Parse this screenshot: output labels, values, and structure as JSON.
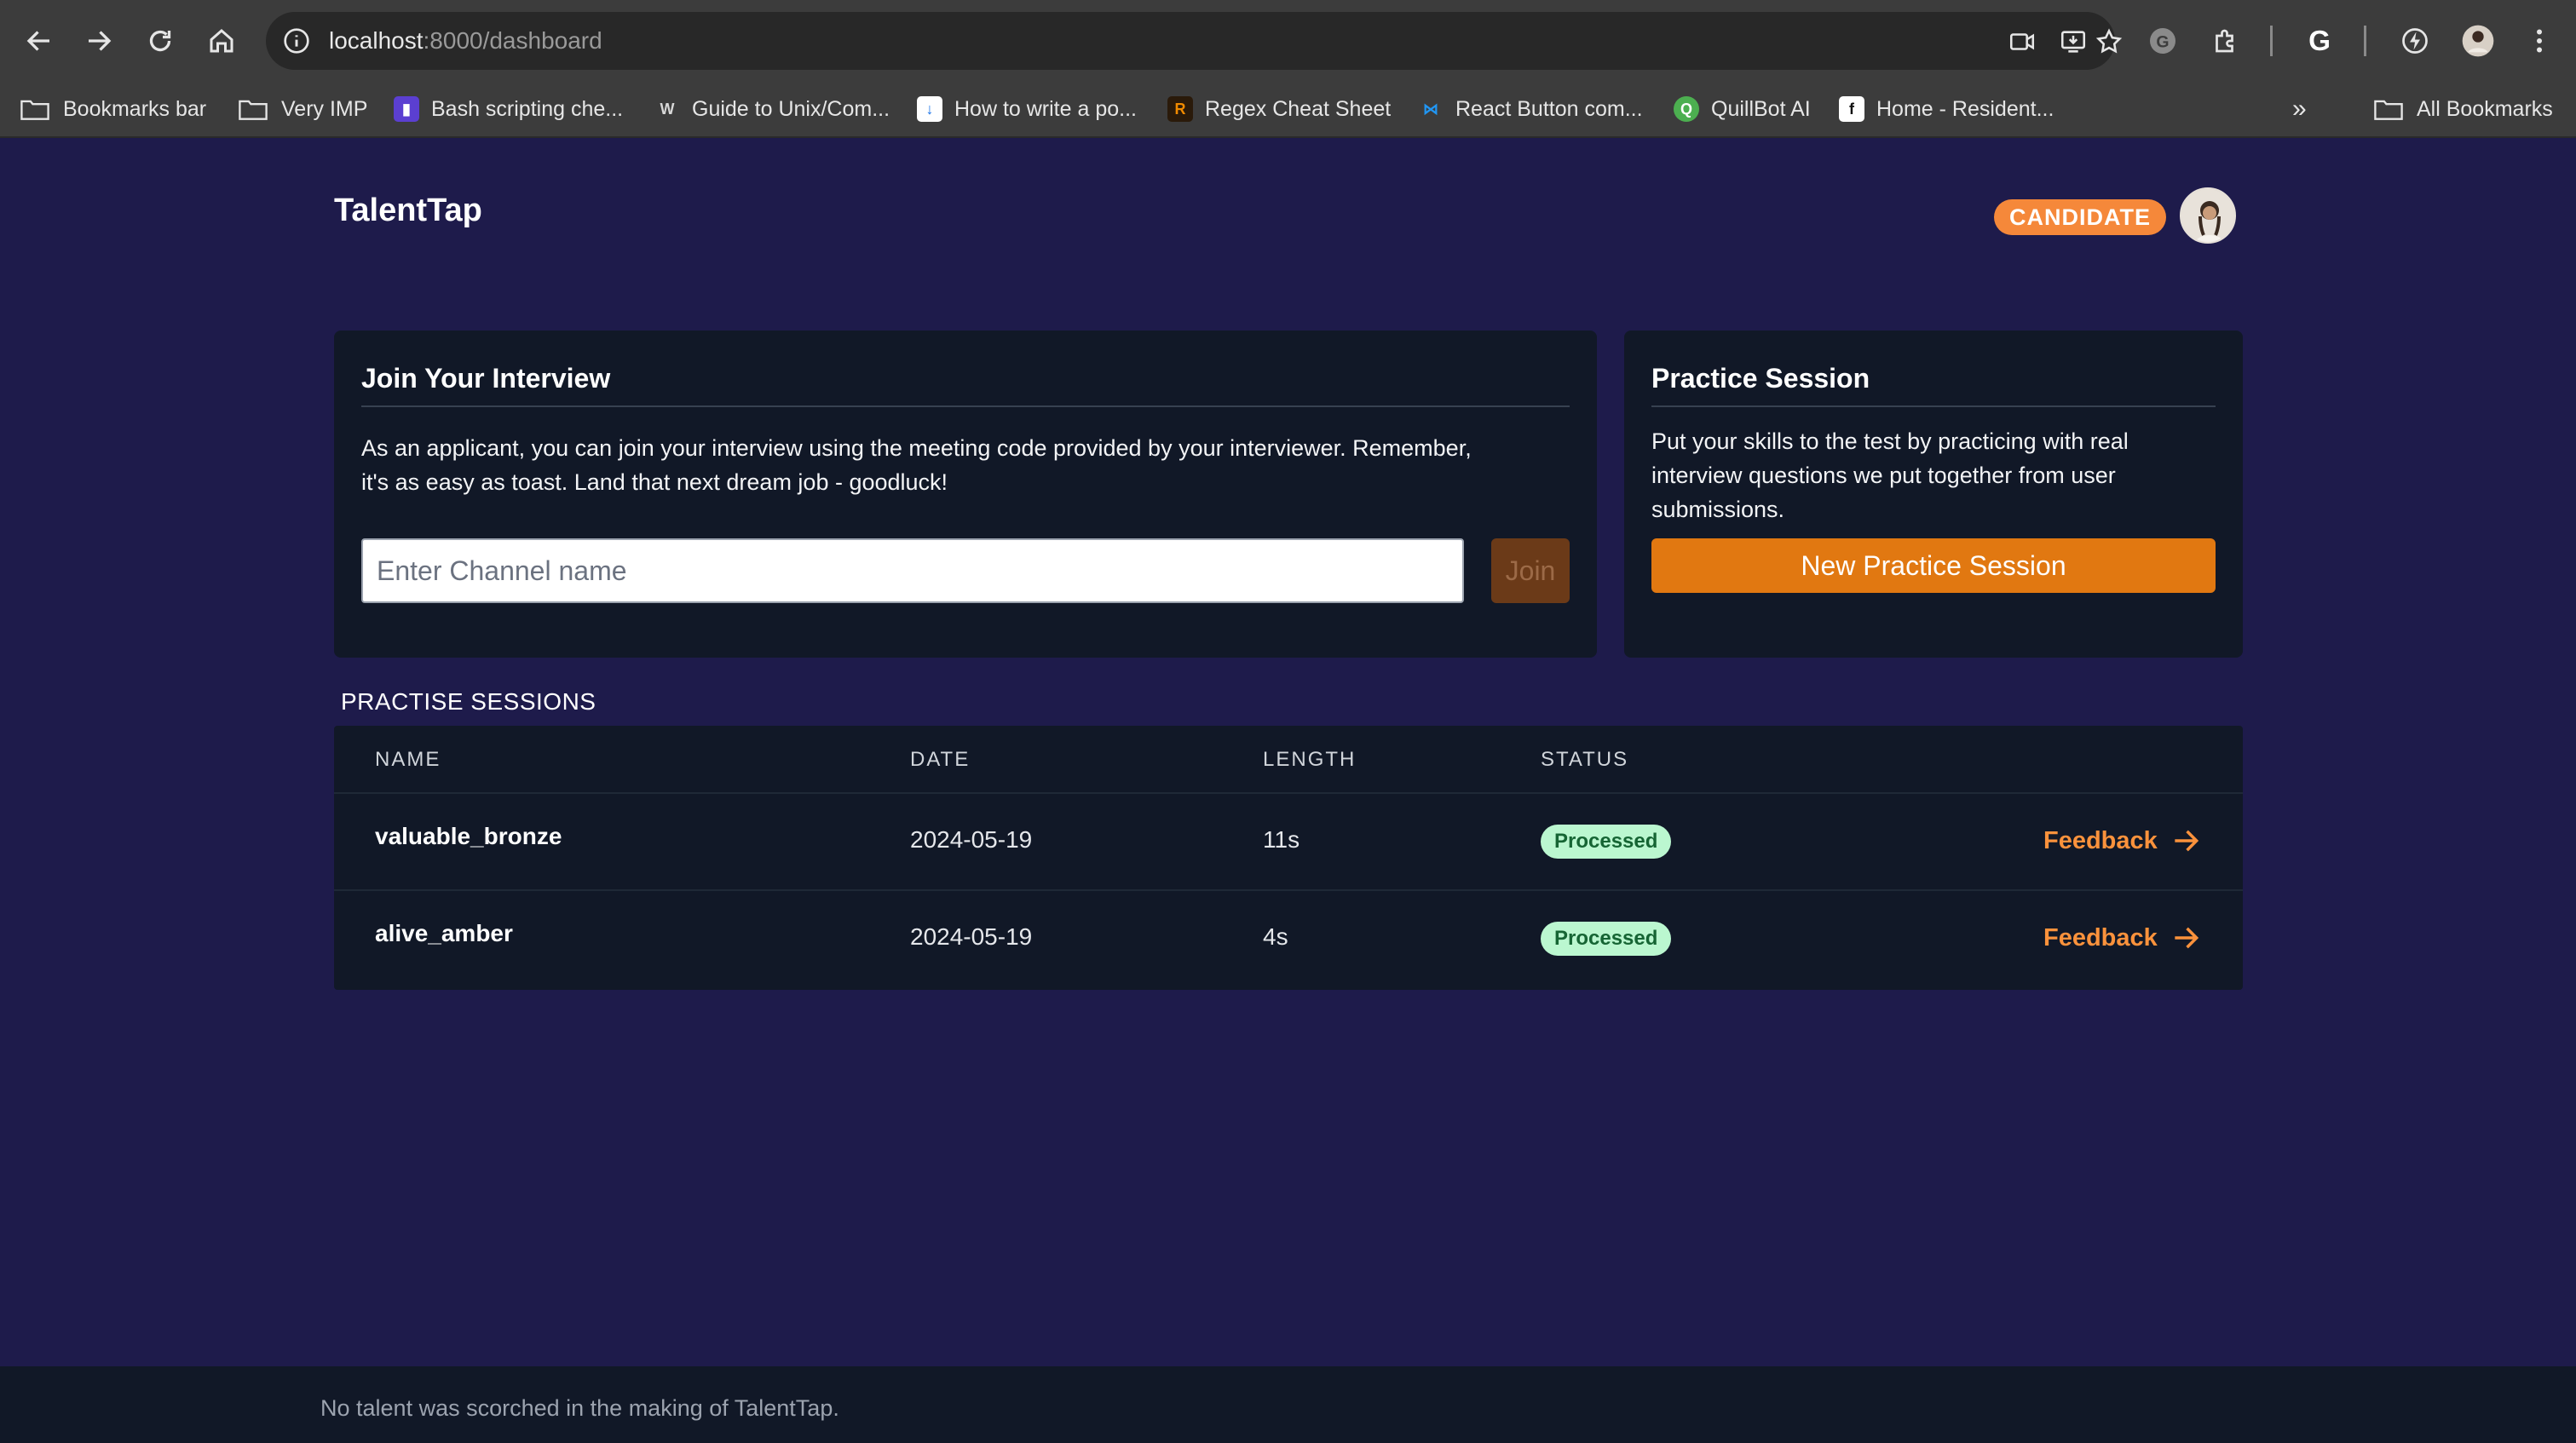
{
  "browser": {
    "url_host": "localhost",
    "url_path": ":8000/dashboard",
    "bookmarks": [
      {
        "label": "Bookmarks bar",
        "icon": "folder-icon"
      },
      {
        "label": "Very IMP",
        "icon": "folder-icon"
      },
      {
        "label": "Bash scripting che...",
        "icon": "bash-favicon"
      },
      {
        "label": "Guide to Unix/Com...",
        "icon": "guide-favicon"
      },
      {
        "label": "How to write a po...",
        "icon": "howto-favicon"
      },
      {
        "label": "Regex Cheat Sheet",
        "icon": "regex-favicon"
      },
      {
        "label": "React Button com...",
        "icon": "react-favicon"
      },
      {
        "label": "QuillBot AI",
        "icon": "quillbot-favicon"
      },
      {
        "label": "Home - Resident...",
        "icon": "resident-favicon"
      }
    ],
    "all_bookmarks_label": "All Bookmarks"
  },
  "header": {
    "brand": "TalentTap",
    "role_badge": "CANDIDATE"
  },
  "join_card": {
    "title": "Join Your Interview",
    "description_line1": "As an applicant, you can join your interview using the meeting code provided by your interviewer. Remember,",
    "description_line2": "it's as easy as toast. Land that next dream job - goodluck!",
    "input_placeholder": "Enter Channel name",
    "join_label": "Join"
  },
  "practice_card": {
    "title": "Practice Session",
    "description_line1": "Put your skills to the test by practicing with real",
    "description_line2": "interview questions we put together from user",
    "description_line3": "submissions.",
    "button_label": "New Practice Session"
  },
  "sessions": {
    "section_title": "PRACTISE SESSIONS",
    "columns": [
      "NAME",
      "DATE",
      "LENGTH",
      "STATUS"
    ],
    "rows": [
      {
        "name": "valuable_bronze",
        "date": "2024-05-19",
        "length": "11s",
        "status": "Processed",
        "action": "Feedback"
      },
      {
        "name": "alive_amber",
        "date": "2024-05-19",
        "length": "4s",
        "status": "Processed",
        "action": "Feedback"
      }
    ]
  },
  "footer": {
    "text": "No talent was scorched in the making of TalentTap."
  },
  "colors": {
    "page_bg": "#1e1b4b",
    "card_bg": "#111827",
    "accent": "#e17811",
    "badge": "#f5883a",
    "status_bg": "#bbf7d0"
  }
}
